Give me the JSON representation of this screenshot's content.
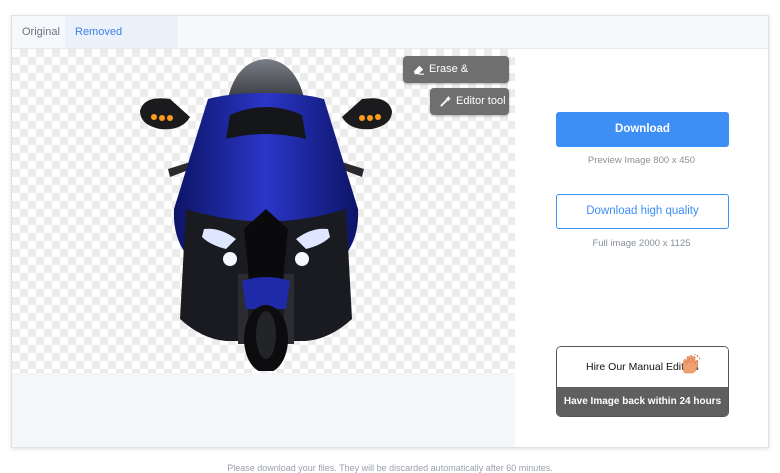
{
  "tabs": [
    {
      "label": "Original",
      "active": false
    },
    {
      "label": "Removed Background",
      "active": true
    }
  ],
  "tools": {
    "erase_restore": "Erase & Restore",
    "editor_tool": "Editor tool"
  },
  "download": {
    "label": "Download",
    "preview_text": "Preview Image   800 x 450",
    "hq_label": "Download high quality",
    "full_text": "Full image   2000 x 1125"
  },
  "hire": {
    "title": "Hire Our Manual Editors",
    "subtitle": "Have Image back within 24 hours"
  },
  "footer": "Please download your files. They will be discarded automatically after 60 minutes.",
  "colors": {
    "accent": "#3d8ff5",
    "tool_bg": "#6f6f6f",
    "bike_blue": "#1e2aa8"
  },
  "icons": [
    "eraser-icon",
    "magic-wand-icon",
    "hand-icon"
  ]
}
